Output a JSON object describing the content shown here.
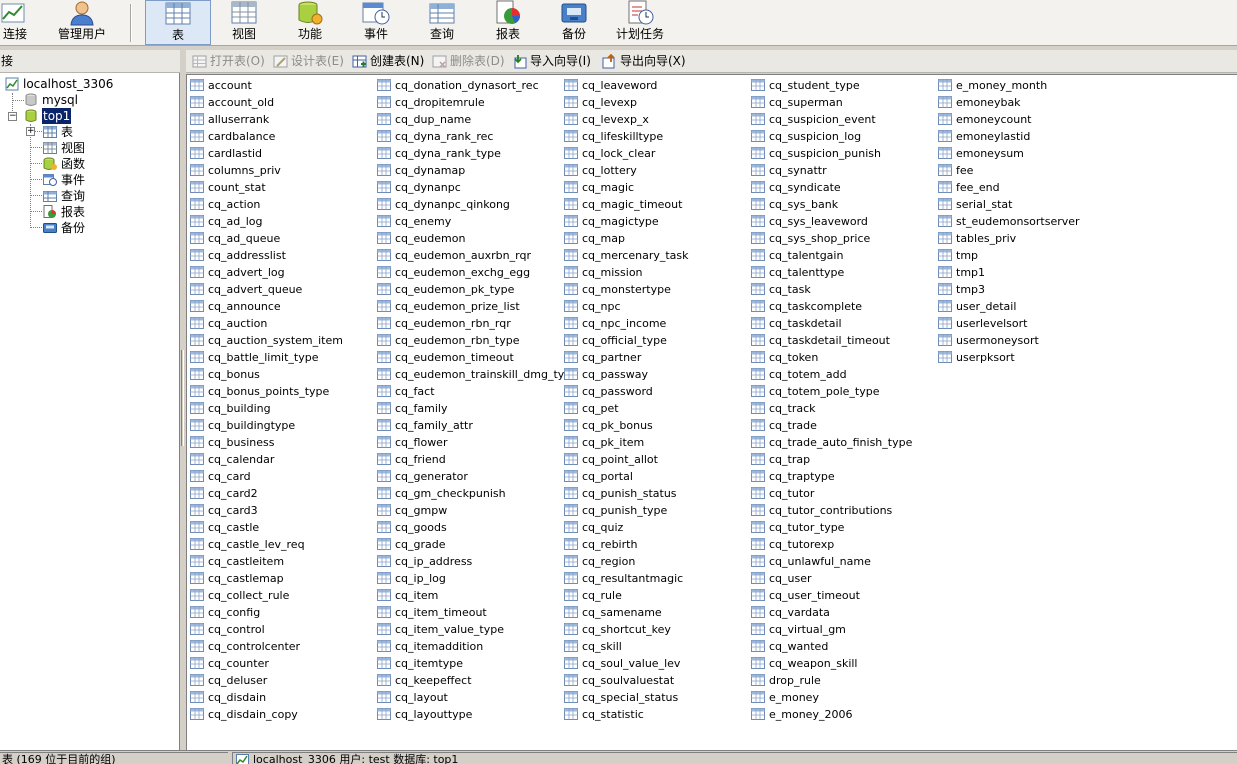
{
  "toolbar": {
    "items": [
      {
        "label": "连接",
        "icon": "connection-chart-icon"
      },
      {
        "label": "管理用户",
        "icon": "user-icon"
      },
      {
        "label": "表",
        "icon": "table-grid-icon"
      },
      {
        "label": "视图",
        "icon": "view-icon"
      },
      {
        "label": "功能",
        "icon": "function-database-icon"
      },
      {
        "label": "事件",
        "icon": "event-clock-icon"
      },
      {
        "label": "查询",
        "icon": "query-icon"
      },
      {
        "label": "报表",
        "icon": "report-icon"
      },
      {
        "label": "备份",
        "icon": "backup-icon"
      },
      {
        "label": "计划任务",
        "icon": "schedule-icon"
      }
    ],
    "active": "表"
  },
  "left_panel": {
    "header": "接",
    "tree": {
      "connection": "localhost_3306",
      "databases": [
        "mysql",
        "top1"
      ],
      "selected_database": "top1",
      "children": [
        "表",
        "视图",
        "函数",
        "事件",
        "查询",
        "报表",
        "备份"
      ]
    }
  },
  "object_toolbar": {
    "open_table": "打开表(O)",
    "design_table": "设计表(E)",
    "create_table": "创建表(N)",
    "delete_table": "删除表(D)",
    "import_wizard": "导入向导(I)",
    "export_wizard": "导出向导(X)"
  },
  "tables": [
    [
      "account",
      "account_old",
      "alluserrank",
      "cardbalance",
      "cardlastid",
      "columns_priv",
      "count_stat",
      "cq_action",
      "cq_ad_log",
      "cq_ad_queue",
      "cq_addresslist",
      "cq_advert_log",
      "cq_advert_queue",
      "cq_announce",
      "cq_auction",
      "cq_auction_system_item",
      "cq_battle_limit_type",
      "cq_bonus",
      "cq_bonus_points_type",
      "cq_building",
      "cq_buildingtype",
      "cq_business",
      "cq_calendar",
      "cq_card",
      "cq_card2",
      "cq_card3",
      "cq_castle",
      "cq_castle_lev_req",
      "cq_castleitem",
      "cq_castlemap",
      "cq_collect_rule",
      "cq_config",
      "cq_control",
      "cq_controlcenter",
      "cq_counter",
      "cq_deluser",
      "cq_disdain",
      "cq_disdain_copy"
    ],
    [
      "cq_donation_dynasort_rec",
      "cq_dropitemrule",
      "cq_dup_name",
      "cq_dyna_rank_rec",
      "cq_dyna_rank_type",
      "cq_dynamap",
      "cq_dynanpc",
      "cq_dynanpc_qinkong",
      "cq_enemy",
      "cq_eudemon",
      "cq_eudemon_auxrbn_rqr",
      "cq_eudemon_exchg_egg",
      "cq_eudemon_pk_type",
      "cq_eudemon_prize_list",
      "cq_eudemon_rbn_rqr",
      "cq_eudemon_rbn_type",
      "cq_eudemon_timeout",
      "cq_eudemon_trainskill_dmg_type",
      "cq_fact",
      "cq_family",
      "cq_family_attr",
      "cq_flower",
      "cq_friend",
      "cq_generator",
      "cq_gm_checkpunish",
      "cq_gmpw",
      "cq_goods",
      "cq_grade",
      "cq_ip_address",
      "cq_ip_log",
      "cq_item",
      "cq_item_timeout",
      "cq_item_value_type",
      "cq_itemaddition",
      "cq_itemtype",
      "cq_keepeffect",
      "cq_layout",
      "cq_layouttype"
    ],
    [
      "cq_leaveword",
      "cq_levexp",
      "cq_levexp_x",
      "cq_lifeskilltype",
      "cq_lock_clear",
      "cq_lottery",
      "cq_magic",
      "cq_magic_timeout",
      "cq_magictype",
      "cq_map",
      "cq_mercenary_task",
      "cq_mission",
      "cq_monstertype",
      "cq_npc",
      "cq_npc_income",
      "cq_official_type",
      "cq_partner",
      "cq_passway",
      "cq_password",
      "cq_pet",
      "cq_pk_bonus",
      "cq_pk_item",
      "cq_point_allot",
      "cq_portal",
      "cq_punish_status",
      "cq_punish_type",
      "cq_quiz",
      "cq_rebirth",
      "cq_region",
      "cq_resultantmagic",
      "cq_rule",
      "cq_samename",
      "cq_shortcut_key",
      "cq_skill",
      "cq_soul_value_lev",
      "cq_soulvaluestat",
      "cq_special_status",
      "cq_statistic"
    ],
    [
      "cq_student_type",
      "cq_superman",
      "cq_suspicion_event",
      "cq_suspicion_log",
      "cq_suspicion_punish",
      "cq_synattr",
      "cq_syndicate",
      "cq_sys_bank",
      "cq_sys_leaveword",
      "cq_sys_shop_price",
      "cq_talentgain",
      "cq_talenttype",
      "cq_task",
      "cq_taskcomplete",
      "cq_taskdetail",
      "cq_taskdetail_timeout",
      "cq_token",
      "cq_totem_add",
      "cq_totem_pole_type",
      "cq_track",
      "cq_trade",
      "cq_trade_auto_finish_type",
      "cq_trap",
      "cq_traptype",
      "cq_tutor",
      "cq_tutor_contributions",
      "cq_tutor_type",
      "cq_tutorexp",
      "cq_unlawful_name",
      "cq_user",
      "cq_user_timeout",
      "cq_vardata",
      "cq_virtual_gm",
      "cq_wanted",
      "cq_weapon_skill",
      "drop_rule",
      "e_money",
      "e_money_2006"
    ],
    [
      "e_money_month",
      "emoneybak",
      "emoneycount",
      "emoneylastid",
      "emoneysum",
      "fee",
      "fee_end",
      "serial_stat",
      "st_eudemonsortserver",
      "tables_priv",
      "tmp",
      "tmp1",
      "tmp3",
      "user_detail",
      "userlevelsort",
      "usermoneysort",
      "userpksort"
    ]
  ],
  "status": {
    "count_text": "表 (169 位于目前的组)",
    "connection_text": "localhost_3306   用户: test   数据库: top1"
  }
}
